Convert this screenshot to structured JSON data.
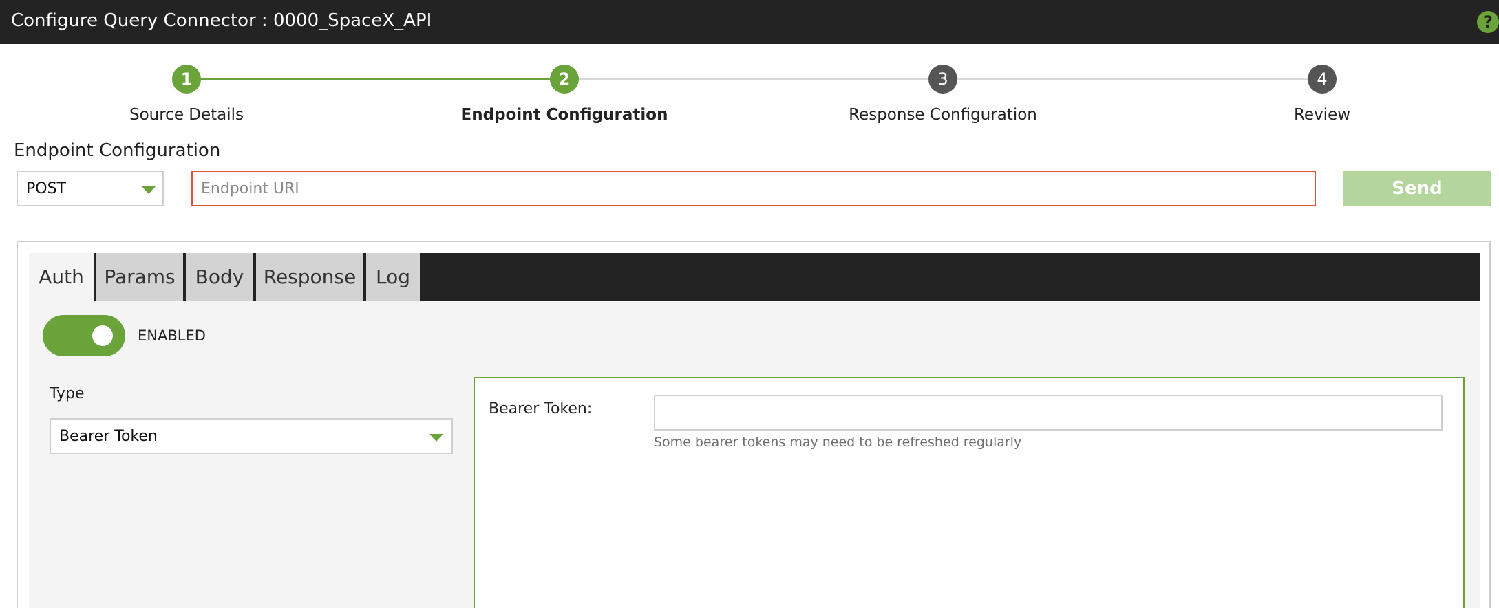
{
  "window": {
    "title": "Configure Query Connector : 0000_SpaceX_API",
    "help_icon": "?"
  },
  "stepper": {
    "steps": [
      {
        "number": "1",
        "label": "Source Details",
        "state": "complete"
      },
      {
        "number": "2",
        "label": "Endpoint Configuration",
        "state": "current"
      },
      {
        "number": "3",
        "label": "Response Configuration",
        "state": "upcoming"
      },
      {
        "number": "4",
        "label": "Review",
        "state": "upcoming"
      }
    ]
  },
  "endpoint": {
    "section_title": "Endpoint Configuration",
    "method": "POST",
    "uri_value": "",
    "uri_placeholder": "Endpoint URI",
    "send_label": "Send"
  },
  "tabs": [
    {
      "label": "Auth",
      "active": true
    },
    {
      "label": "Params",
      "active": false
    },
    {
      "label": "Body",
      "active": false
    },
    {
      "label": "Response",
      "active": false
    },
    {
      "label": "Log",
      "active": false
    }
  ],
  "auth": {
    "toggle_state": true,
    "toggle_label": "ENABLED",
    "type_label": "Type",
    "type_value": "Bearer Token",
    "bearer_label": "Bearer Token:",
    "bearer_value": "",
    "bearer_hint": "Some bearer tokens may need to be refreshed regularly"
  },
  "colors": {
    "accent": "#6aa339",
    "titlebar": "#232323",
    "error_border": "#d9533e",
    "send_disabled": "#b4d69c",
    "upcoming_step": "#555555"
  }
}
